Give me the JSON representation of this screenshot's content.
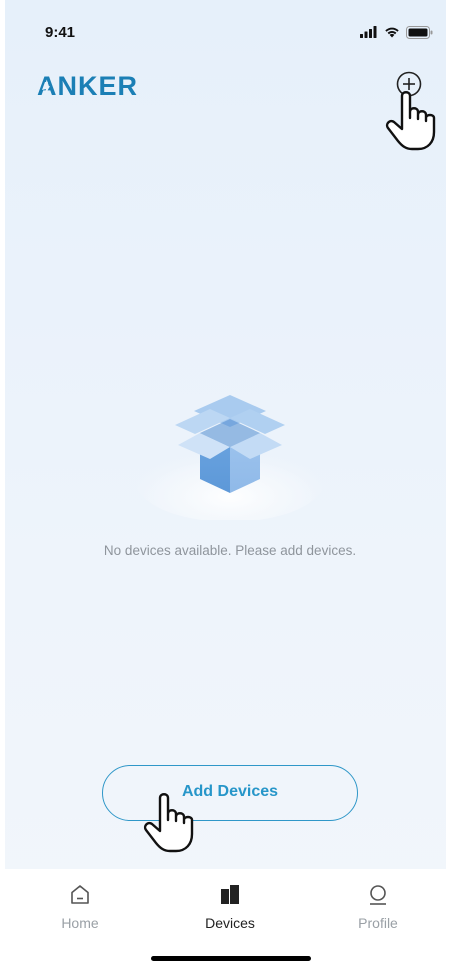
{
  "status_bar": {
    "time": "9:41"
  },
  "header": {
    "logo_text": "ANKER",
    "add_icon": "circle-plus-icon"
  },
  "empty_state": {
    "illustration": "open-box-icon",
    "message": "No devices available. Please add devices."
  },
  "add_devices_button": {
    "label": "Add Devices"
  },
  "tab_bar": {
    "tabs": [
      {
        "label": "Home",
        "icon": "home-icon",
        "active": false
      },
      {
        "label": "Devices",
        "icon": "devices-icon",
        "active": true
      },
      {
        "label": "Profile",
        "icon": "profile-icon",
        "active": false
      }
    ]
  },
  "colors": {
    "accent": "#2796c9",
    "logo": "#1b7fb5",
    "background": "#eaf2fb",
    "muted_text": "#8f959c"
  }
}
